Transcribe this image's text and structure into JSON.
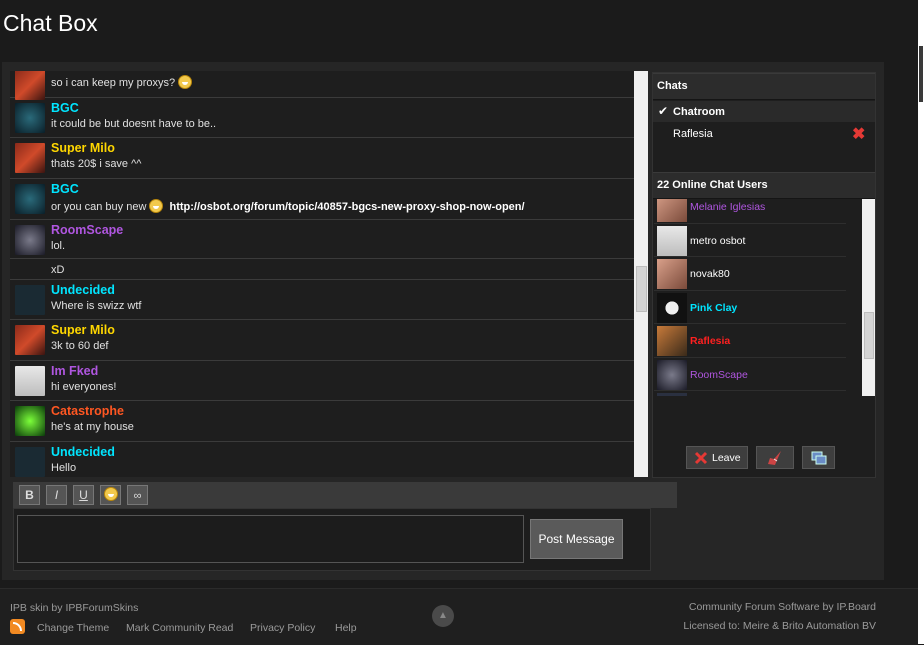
{
  "page": {
    "title": "Chat Box"
  },
  "messages": [
    {
      "user": "",
      "text_before": "so i can keep my proxys?",
      "smiley_after": true,
      "user_color": "#ffd700",
      "avatar": "red-figure-avatar",
      "h": 33
    },
    {
      "user": "BGC",
      "text": "it could be but doesnt have to be..",
      "user_color": "#00e5ff",
      "avatar": "bgc-avatar",
      "h": 40
    },
    {
      "user": "Super Milo",
      "text": "thats 20$ i save ^^",
      "user_color": "#ffd700",
      "avatar": "red-figure-avatar",
      "h": 41
    },
    {
      "user": "BGC",
      "text_before": "or you can buy new",
      "smiley": true,
      "link": "http://osbot.org/forum/topic/40857-bgcs-new-proxy-shop-now-open/",
      "user_color": "#00e5ff",
      "avatar": "bgc-avatar",
      "h": 41
    },
    {
      "user": "RoomScape",
      "text": "lol.",
      "user_color": "#b056e0",
      "avatar": "roomscape-avatar",
      "h": 39
    },
    {
      "user": "",
      "text": "xD",
      "user_color": "#ffffff",
      "avatar": "",
      "h": 21
    },
    {
      "user": "Undecided",
      "text": "Where is swizz wtf",
      "user_color": "#00e5ff",
      "avatar": "undecided-avatar",
      "h": 40
    },
    {
      "user": "Super Milo",
      "text": "3k to 60 def",
      "user_color": "#ffd700",
      "avatar": "red-figure-avatar",
      "h": 41
    },
    {
      "user": "Im Fked",
      "text": "hi everyones!",
      "user_color": "#b056e0",
      "avatar": "default-avatar",
      "h": 40
    },
    {
      "user": "Catastrophe",
      "text": "he's at my house",
      "user_color": "#ff5722",
      "avatar": "catastrophe-avatar",
      "h": 41
    },
    {
      "user": "Undecided",
      "text": "Hello",
      "user_color": "#00e5ff",
      "avatar": "undecided-avatar",
      "h": 40
    }
  ],
  "sidebar": {
    "chats_header": "Chats",
    "rooms": [
      {
        "name": "Chatroom",
        "active": true
      },
      {
        "name": "Raflesia",
        "active": false
      }
    ],
    "users_header": "22 Online Chat Users",
    "users": [
      {
        "name": "Melanie Iglesias",
        "color": "#b056e0",
        "avatar": "photo-avatar"
      },
      {
        "name": "metro osbot",
        "color": "#ffffff",
        "avatar": "default-avatar"
      },
      {
        "name": "novak80",
        "color": "#ffffff",
        "avatar": "photo-avatar"
      },
      {
        "name": "Pink Clay",
        "color": "#00e5ff",
        "avatar": "mask-avatar",
        "bold": true
      },
      {
        "name": "Raflesia",
        "color": "#ff2020",
        "avatar": "tiger-avatar",
        "bold": true
      },
      {
        "name": "RoomScape",
        "color": "#b056e0",
        "avatar": "roomscape-avatar"
      },
      {
        "name": "",
        "color": "#ffffff",
        "avatar": "dark-avatar"
      }
    ],
    "leave_label": "Leave"
  },
  "editor": {
    "bold_label": "B",
    "italic_label": "I",
    "underline_label": "U",
    "post_label": "Post Message",
    "message_value": ""
  },
  "footer": {
    "skin_credit": "IPB skin by IPBForumSkins",
    "links": [
      "Change Theme",
      "Mark Community Read",
      "Privacy Policy",
      "Help"
    ],
    "software_credit": "Community Forum Software by IP.Board",
    "license": "Licensed to: Meire & Brito Automation BV"
  }
}
